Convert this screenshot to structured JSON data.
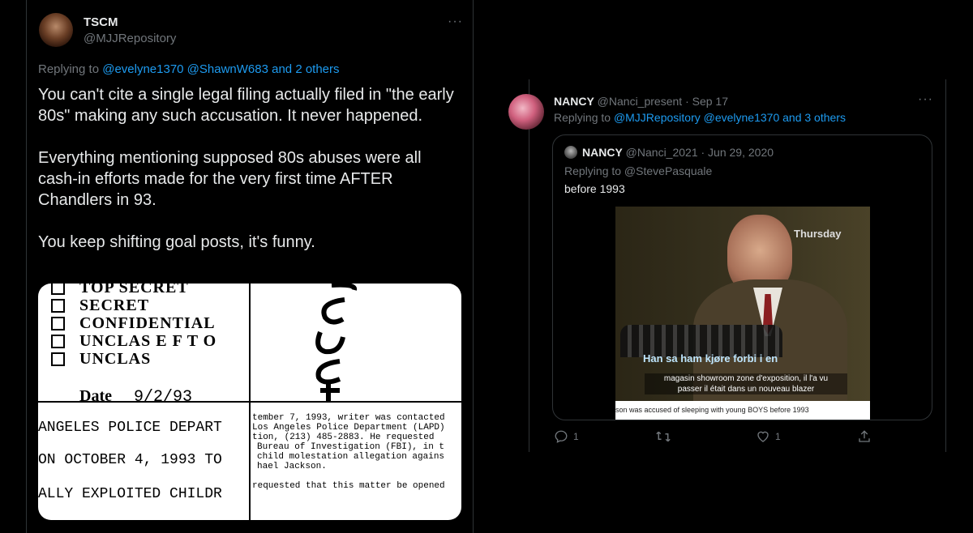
{
  "left_tweet": {
    "author_name": "TSCM",
    "author_handle": "@MJJRepository",
    "replying_prefix": "Replying to ",
    "replying_users": "@evelyne1370 @ShawnW683 and 2 others",
    "paragraphs": [
      "You can't cite a single legal filing actually filed in \"the early 80s\" making any such accusation. It never happened.",
      "Everything mentioning supposed 80s abuses were all cash-in efforts made for the very first time AFTER Chandlers in 93.",
      "You keep shifting goal posts, it's funny."
    ],
    "more_icon": "ellipsis-icon",
    "document": {
      "checkboxes": [
        "TOP SECRET",
        "SECRET",
        "CONFIDENTIAL",
        "UNCLAS E F T O",
        "UNCLAS"
      ],
      "date_label": "Date",
      "date_value": "9/2/93",
      "left_rows": [
        "ANGELES POLICE DEPART",
        "ON OCTOBER 4, 1993 TO",
        "ALLY EXPLOITED CHILDR"
      ],
      "right_lines": [
        "tember 7, 1993, writer was contacted",
        "Los Angeles Police Department (LAPD)",
        "tion, (213) 485-2883.  He requested",
        "Bureau of Investigation (FBI), in t",
        "child molestation allegation agains",
        "hael Jackson.",
        "requested that this matter be opened"
      ]
    }
  },
  "right_tweet": {
    "author_name": "NANCY",
    "author_handle": "@Nanci_present",
    "date": "· Sep 17",
    "replying_prefix": "Replying to ",
    "replying_users": "@MJJRepository @evelyne1370 and 3 others",
    "more_icon": "ellipsis-icon",
    "quoted": {
      "author_name": "NANCY",
      "author_handle": "@Nanci_2021",
      "date": "· Jun 29, 2020",
      "replying_line": "Replying to @StevePasquale",
      "text": "before 1993",
      "video": {
        "corner_label": "Thursday",
        "caption_top": "Han sa ham kjøre forbi i en",
        "caption_fr_1": "magasin showroom zone d'exposition, il l'a vu",
        "caption_fr_2": "passer il était dans un nouveau blazer",
        "bottom_banner": "son was accused of sleeping with young BOYS before 1993"
      }
    },
    "actions": {
      "reply_icon": "reply-icon",
      "reply_count": "1",
      "retweet_icon": "retweet-icon",
      "like_icon": "heart-icon",
      "like_count": "1",
      "share_icon": "share-icon"
    }
  },
  "colors": {
    "background": "#000000",
    "border": "#2f3336",
    "text": "#e7e9ea",
    "muted": "#71767b",
    "link": "#1d9bf0"
  }
}
